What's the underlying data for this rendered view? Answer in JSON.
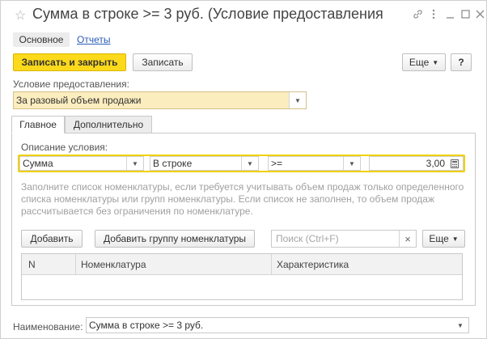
{
  "window": {
    "title": "Сумма в строке >= 3 руб. (Условие предоставления",
    "icons": [
      "star-icon",
      "link-icon",
      "more-vertical-icon",
      "minimize-icon",
      "maximize-icon",
      "close-icon"
    ]
  },
  "nav": {
    "tabs": [
      {
        "label": "Основное"
      },
      {
        "label": "Отчеты"
      }
    ]
  },
  "toolbar": {
    "save_close_label": "Записать и закрыть",
    "save_label": "Записать",
    "more_label": "Еще",
    "help_label": "?"
  },
  "condition": {
    "label": "Условие предоставления:",
    "value": "За разовый объем продажи"
  },
  "tabs": [
    {
      "label": "Главное"
    },
    {
      "label": "Дополнительно"
    }
  ],
  "description": {
    "label": "Описание условия:",
    "field1": "Сумма",
    "field2": "В строке",
    "field3": ">=",
    "amount": "3,00"
  },
  "info_text": "Заполните список номенклатуры, если требуется учитывать объем продаж только определенного списка номенклатуры или групп номенклатуры. Если список не заполнен, то объем продаж рассчитывается без ограничения по номенклатуре.",
  "list_toolbar": {
    "add_label": "Добавить",
    "add_group_label": "Добавить группу номенклатуры",
    "search_placeholder": "Поиск (Ctrl+F)",
    "clear_label": "×",
    "more_label": "Еще"
  },
  "table": {
    "columns": [
      "N",
      "Номенклатура",
      "Характеристика"
    ]
  },
  "name": {
    "label": "Наименование:",
    "value": "Сумма в строке >= 3 руб."
  },
  "colors": {
    "accent": "#fcd91a",
    "field_highlight": "#fcedbf"
  }
}
